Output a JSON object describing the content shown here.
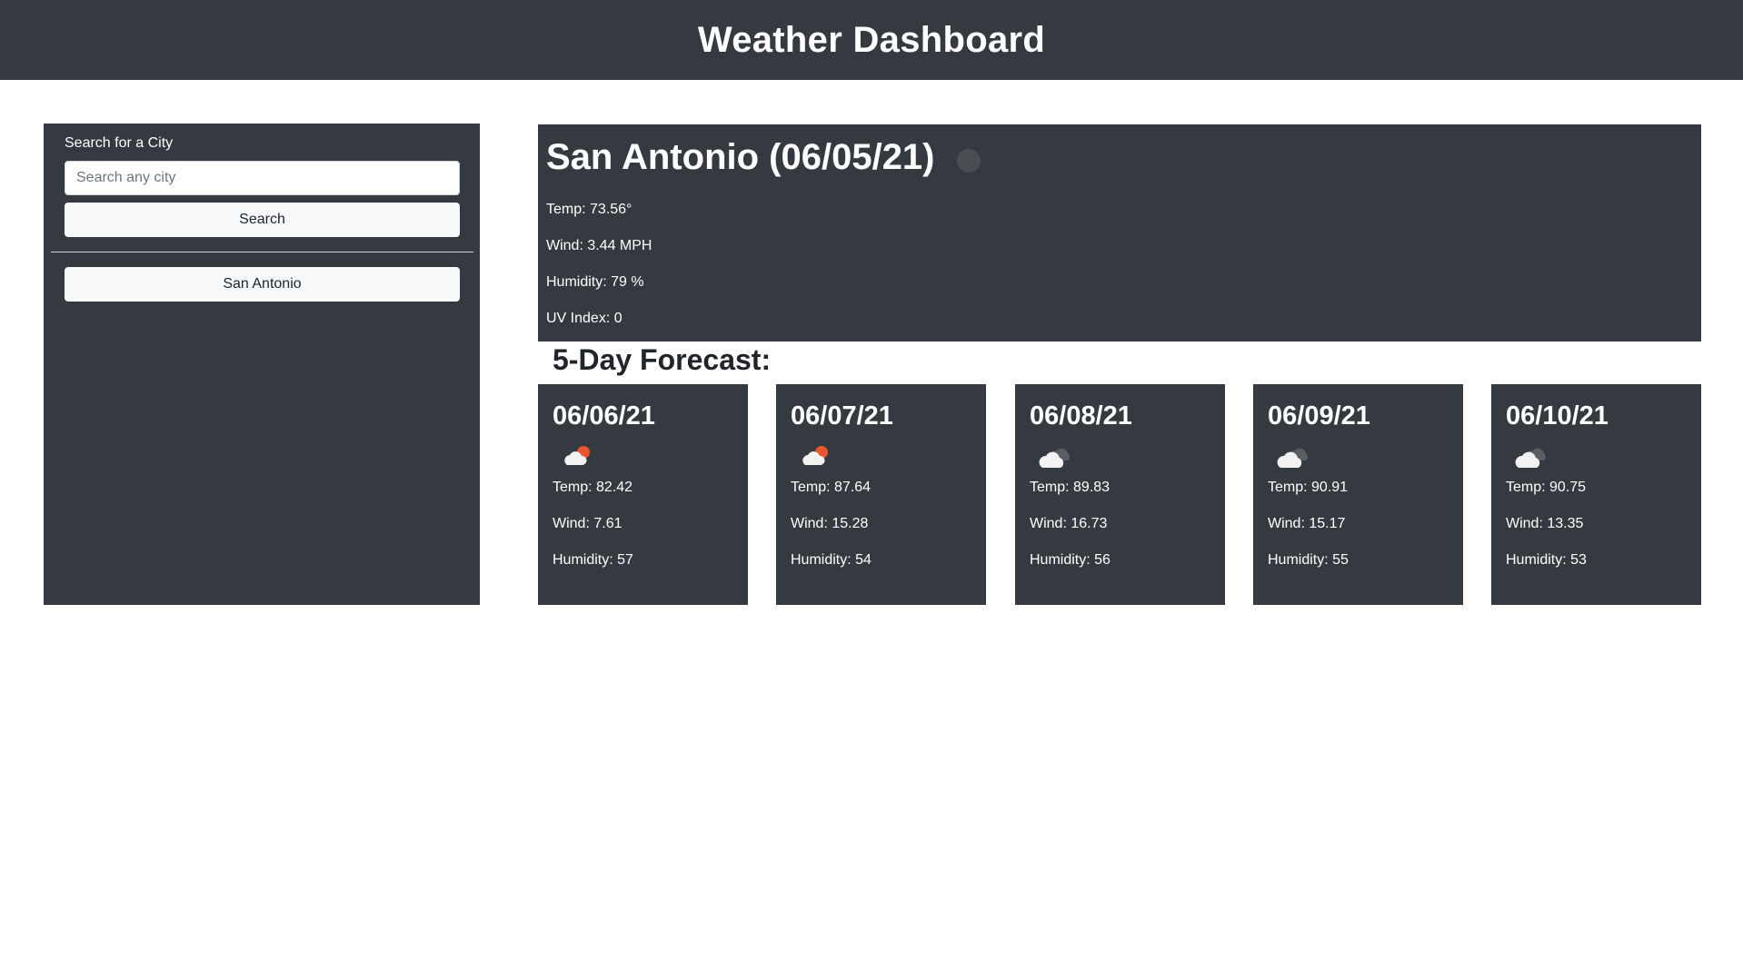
{
  "header": {
    "title": "Weather Dashboard"
  },
  "sidebar": {
    "title": "Search for a City",
    "search_placeholder": "Search any city",
    "search_button": "Search",
    "history": [
      "San Antonio"
    ]
  },
  "current": {
    "title": "San Antonio (06/05/21)",
    "temp": "Temp: 73.56°",
    "wind": "Wind: 3.44 MPH",
    "humidity": "Humidity: 79 %",
    "uv": "UV Index: 0"
  },
  "forecast": {
    "heading": "5-Day Forecast:",
    "days": [
      {
        "date": "06/06/21",
        "icon": "few-clouds-day-icon",
        "temp": "Temp: 82.42",
        "wind": "Wind: 7.61",
        "humidity": "Humidity: 57"
      },
      {
        "date": "06/07/21",
        "icon": "few-clouds-day-icon",
        "temp": "Temp: 87.64",
        "wind": "Wind: 15.28",
        "humidity": "Humidity: 54"
      },
      {
        "date": "06/08/21",
        "icon": "broken-clouds-icon",
        "temp": "Temp: 89.83",
        "wind": "Wind: 16.73",
        "humidity": "Humidity: 56"
      },
      {
        "date": "06/09/21",
        "icon": "broken-clouds-icon",
        "temp": "Temp: 90.91",
        "wind": "Wind: 15.17",
        "humidity": "Humidity: 55"
      },
      {
        "date": "06/10/21",
        "icon": "broken-clouds-icon",
        "temp": "Temp: 90.75",
        "wind": "Wind: 13.35",
        "humidity": "Humidity: 53"
      }
    ]
  },
  "colors": {
    "panel": "#343a40",
    "sun": "#e8552e",
    "cloud": "#f2f2f2",
    "cloud_dark": "#5a5d61"
  }
}
